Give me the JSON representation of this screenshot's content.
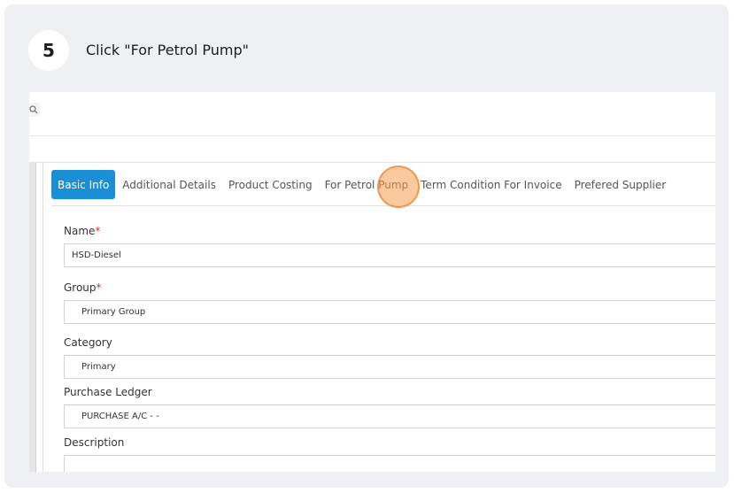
{
  "step": {
    "number": "5",
    "instruction": "Click \"For Petrol Pump\""
  },
  "icons": {
    "search": "search-icon"
  },
  "tabs": [
    {
      "label": "Basic Info",
      "active": true
    },
    {
      "label": "Additional Details",
      "active": false
    },
    {
      "label": "Product Costing",
      "active": false
    },
    {
      "label": "For Petrol Pump",
      "active": false
    },
    {
      "label": "Term Condition For Invoice",
      "active": false
    },
    {
      "label": "Prefered Supplier",
      "active": false
    }
  ],
  "form": {
    "name": {
      "label": "Name",
      "required_mark": "*",
      "value": "HSD-Diesel"
    },
    "group": {
      "label": "Group",
      "required_mark": "*",
      "value": "Primary Group"
    },
    "category": {
      "label": "Category",
      "value": "Primary"
    },
    "purchase_ledger": {
      "label": "Purchase Ledger",
      "value": "PURCHASE A/C - -"
    },
    "description": {
      "label": "Description",
      "value": ""
    }
  },
  "colors": {
    "active_tab": "#1a8fd6",
    "click_marker": "#f59e50",
    "required": "#d9342b"
  }
}
